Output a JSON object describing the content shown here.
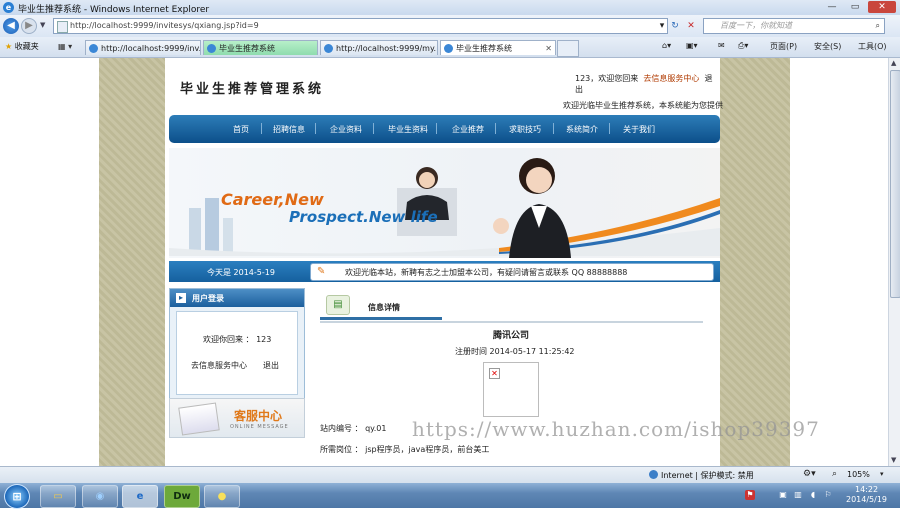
{
  "browser": {
    "window_title": "毕业生推荐系统 - Windows Internet Explorer",
    "url": "http://localhost:9999/invitesys/qxiang.jsp?id=9",
    "search_placeholder": "百度一下，你就知道",
    "favorites_label": "收藏夹",
    "tabs": [
      {
        "label": "http://localhost:9999/inv..."
      },
      {
        "label": "毕业生推荐系统"
      },
      {
        "label": "http://localhost:9999/my..."
      },
      {
        "label": "毕业生推荐系统"
      }
    ],
    "toolbar": {
      "page_label": "页面(P)",
      "safety_label": "安全(S)",
      "tools_label": "工具(O)"
    },
    "status": {
      "zone": "Internet | 保护模式: 禁用",
      "zoom": "105%"
    }
  },
  "site": {
    "logo": "毕业生推荐管理系统",
    "user": "123，欢迎您回来",
    "service_link": "去信息服务中心",
    "logout": "退出",
    "marquee": "欢迎光临毕业生推荐系统，本系统能为您提供",
    "nav": [
      "首页",
      "招聘信息",
      "企业资料",
      "毕业生资料",
      "企业推荐",
      "求职技巧",
      "系统简介",
      "关于我们"
    ],
    "banner": {
      "line1": "Career,New",
      "line2": "Prospect.New life"
    },
    "today": "今天是 2014-5-19",
    "notice": "欢迎光临本站，新聘有志之士加盟本公司，有疑问请留言或联系 QQ 88888888",
    "login": {
      "title": "用户登录",
      "welcome": "欢迎你回来 ： 123",
      "service_link": "去信息服务中心",
      "logout": "退出"
    },
    "service_center": {
      "title": "客服中心",
      "subtitle": "ONLINE MESSAGE"
    },
    "detail": {
      "heading": "信息详情",
      "company": "腾讯公司",
      "reg_time": "注册时间 2014-05-17 11:25:42",
      "fields": [
        {
          "label": "站内编号 ：",
          "value": "qy.01"
        },
        {
          "label": "所需岗位 ：",
          "value": "jsp程序员，java程序员，前台美工"
        }
      ]
    },
    "watermark": "https://www.huzhan.com/ishop39397"
  },
  "taskbar": {
    "time": "14:22",
    "date": "2014/5/19",
    "apps": [
      "explorer",
      "media",
      "ie",
      "Dw",
      "paint"
    ]
  }
}
